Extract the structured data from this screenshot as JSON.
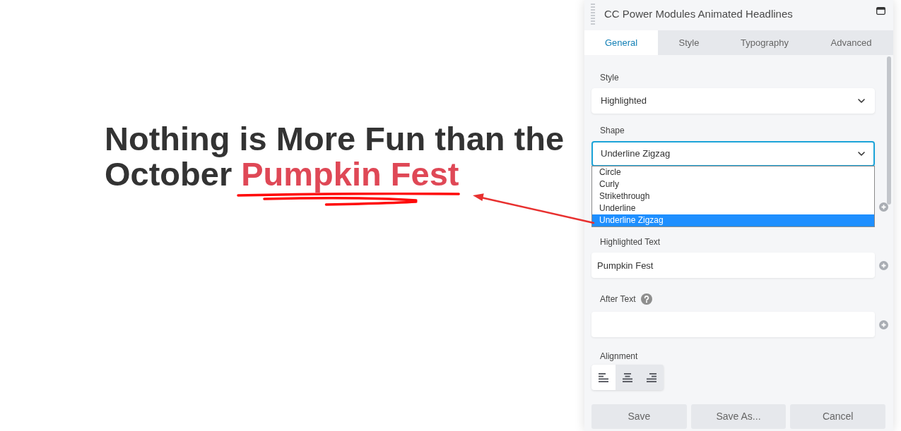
{
  "headline": {
    "text": "Nothing is More Fun than the October",
    "highlighted_text": "Pumpkin Fest"
  },
  "panel": {
    "title": "CC Power Modules Animated Headlines",
    "tabs": [
      {
        "label": "General",
        "selected": true
      },
      {
        "label": "Style",
        "selected": false
      },
      {
        "label": "Typography",
        "selected": false
      },
      {
        "label": "Advanced",
        "selected": false
      }
    ],
    "fields": [
      {
        "kind": "select",
        "label": "Style",
        "value": "Highlighted",
        "expanded": false
      },
      {
        "kind": "select",
        "label": "Shape",
        "value": "Underline Zigzag",
        "expanded": true,
        "options": [
          {
            "label": "Circle",
            "selected": false
          },
          {
            "label": "Curly",
            "selected": false
          },
          {
            "label": "Strikethrough",
            "selected": false
          },
          {
            "label": "Underline",
            "selected": false
          },
          {
            "label": "Underline Zigzag",
            "selected": true
          }
        ]
      },
      {
        "kind": "text",
        "covered": true,
        "connectable": true
      },
      {
        "kind": "text",
        "label": "Highlighted Text",
        "value": "Pumpkin Fest",
        "connectable": true
      },
      {
        "kind": "text",
        "label": "After Text",
        "help": true,
        "connectable": true
      },
      {
        "kind": "alignment",
        "label": "Alignment",
        "options": [
          {
            "kind": "left",
            "selected": true
          },
          {
            "kind": "center",
            "selected": false
          },
          {
            "kind": "right",
            "selected": false
          }
        ]
      }
    ],
    "buttons": [
      "Save",
      "Save As...",
      "Cancel"
    ]
  }
}
